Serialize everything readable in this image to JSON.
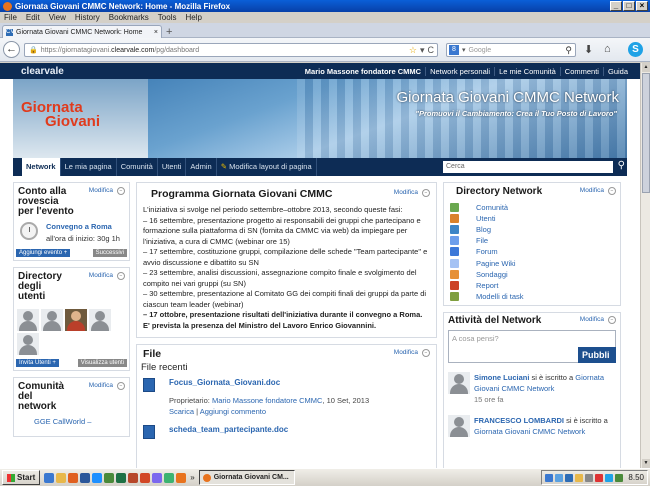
{
  "window": {
    "title": "Giornata Giovani CMMC Network: Home - Mozilla Firefox",
    "controls": [
      "_",
      "□",
      "×"
    ]
  },
  "menu": [
    "File",
    "Edit",
    "View",
    "History",
    "Bookmarks",
    "Tools",
    "Help"
  ],
  "tab": {
    "icon": "CV",
    "label": "Giornata Giovani CMMC Network: Home",
    "close": "×",
    "new_tab": "+"
  },
  "nav": {
    "url_prefix": "https://giornatagiovani.",
    "url_domain": "clearvale.com",
    "url_suffix": "/pg/dashboard",
    "search_placeholder": "Google"
  },
  "site": {
    "logo": "clearvale",
    "top_links": [
      "Mario Massone fondatore CMMC",
      "Network personali",
      "Le mie Comunità",
      "Commenti",
      "Guida"
    ],
    "banner_left_l1": "Giornata",
    "banner_left_l2": "Giovani",
    "banner_title": "Giornata Giovani CMMC Network",
    "banner_sub": "\"Promuovi il Cambiamento: Crea il Tuo Posto di Lavoro\"",
    "nav_items": [
      "Network",
      "Le mia pagina",
      "Comunità",
      "Utenti",
      "Admin",
      "Modifica layout di pagina"
    ],
    "search_placeholder": "Cerca"
  },
  "left": {
    "modify": "Modifica",
    "countdown": {
      "title": "Conto alla rovescia per l'evento",
      "event": "Convegno a Roma",
      "start": "all'ora di inizio: 30g 1h",
      "add": "Aggiungi evento +",
      "next": "Successivi"
    },
    "users": {
      "title": "Directory degli utenti",
      "invite": "Invita Utenti +",
      "view_all": "Visualizza utenti"
    },
    "communities": {
      "title": "Comunità del network",
      "item": "GGE CallWorld –"
    }
  },
  "middle": {
    "program": {
      "title": "Programma Giornata Giovani CMMC",
      "modify": "Modifica",
      "lines": [
        "L'iniziativa si svolge nel periodo settembre–ottobre 2013, secondo queste fasi:",
        "– 16 settembre, presentazione progetto ai responsabili dei gruppi che partecipano e formazione sulla piattaforma di SN (fornita da CMMC via web) da impiegare per l'iniziativa, a cura di CMMC (webinar ore 15)",
        "– 17 settembre, costituzione gruppi, compilazione delle schede \"Team partecipante\" e avvio discussione e dibattito su SN",
        "– 23 settembre, analisi discussioni, assegnazione compito finale e svolgimento del compito nei vari gruppi (su SN)",
        "– 30 settembre, presentazione al Comitato GG dei compiti finali dei gruppi da parte di ciascun team leader (webinar)"
      ],
      "bold": "– 17 ottobre, presentazione risultati dell'iniziativa durante il convegno a Roma. E' prevista la presenza del Ministro del Lavoro Enrico Giovannini."
    },
    "files": {
      "title": "File",
      "modify": "Modifica",
      "recent": "File recenti",
      "items": [
        {
          "name": "Focus_Giornata_Giovani.doc",
          "owner_label": "Proprietario:",
          "owner": "Mario Massone fondatore CMMC",
          "date": ", 10 Set, 2013",
          "download": "Scarica",
          "sep": " | ",
          "comment": "Aggiungi commento"
        },
        {
          "name": "scheda_team_partecipante.doc"
        }
      ]
    }
  },
  "right": {
    "directory": {
      "title": "Directory Network",
      "modify": "Modifica",
      "items": [
        {
          "label": "Comunità",
          "icon": "community-icon",
          "color": "#6aa84f"
        },
        {
          "label": "Utenti",
          "icon": "user-icon",
          "color": "#d9822b"
        },
        {
          "label": "Blog",
          "icon": "blog-icon",
          "color": "#3d85c6"
        },
        {
          "label": "File",
          "icon": "file-icon",
          "color": "#6d9eeb"
        },
        {
          "label": "Forum",
          "icon": "forum-icon",
          "color": "#3c78d8"
        },
        {
          "label": "Pagine Wiki",
          "icon": "wiki-icon",
          "color": "#a4c2f4"
        },
        {
          "label": "Sondaggi",
          "icon": "poll-icon",
          "color": "#e69138"
        },
        {
          "label": "Report",
          "icon": "report-icon",
          "color": "#cc4125"
        },
        {
          "label": "Modelli di task",
          "icon": "task-icon",
          "color": "#7f9f3f"
        }
      ]
    },
    "activity": {
      "title": "Attività del Network",
      "modify": "Modifica",
      "placeholder": "A cosa pensi?",
      "publish": "Pubbli",
      "entries": [
        {
          "name": "Simone Luciani",
          "text": " si è iscritto a ",
          "link": "Giornata Giovani CMMC Network",
          "time": "15 ore fa"
        },
        {
          "name": "FRANCESCO LOMBARDI",
          "text": " si è iscritto a ",
          "link": "Giornata Giovani CMMC Network",
          "time": ""
        }
      ]
    }
  },
  "taskbar": {
    "start": "Start",
    "task": "Giornata Giovani CM...",
    "more": "»",
    "clock": "8.50"
  }
}
